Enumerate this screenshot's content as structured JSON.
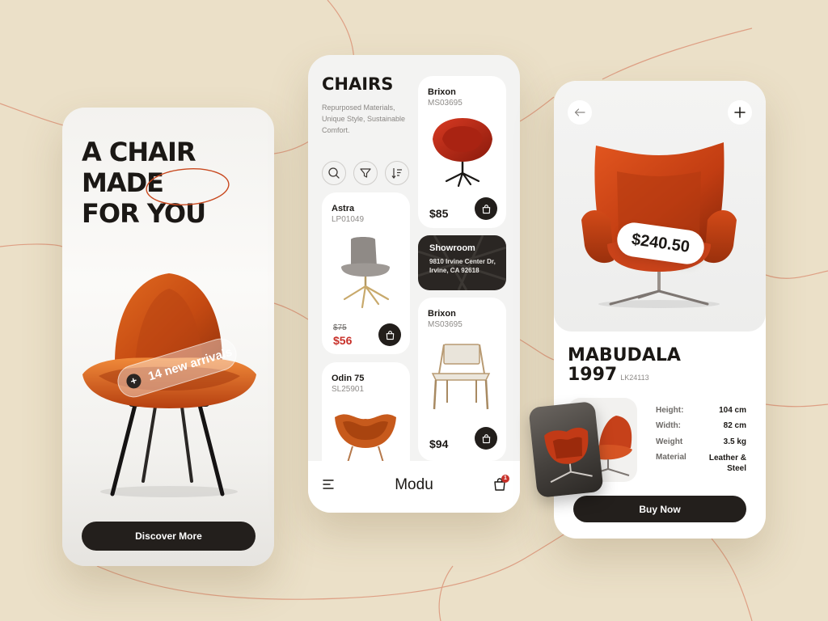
{
  "colors": {
    "background": "#ebe0c8",
    "accent_orange": "#c8481e",
    "dark": "#231f1c",
    "sale_red": "#c8312a"
  },
  "screen1": {
    "headline": [
      "A CHAIR",
      "MADE",
      "FOR YOU"
    ],
    "arrivals_label": "14 new arrivals",
    "discover_label": "Discover More"
  },
  "screen2": {
    "title": "CHAIRS",
    "description": "Repurposed Materials, Unique Style, Sustainable Comfort.",
    "tool_icons": [
      "search-icon",
      "filter-icon",
      "sort-icon"
    ],
    "products": [
      {
        "name": "Brixon",
        "code": "MS03695",
        "price": "$85"
      },
      {
        "name": "Astra",
        "code": "LP01049",
        "old_price": "$75",
        "price": "$56"
      },
      {
        "name": "Brixon",
        "code": "MS03695",
        "price": "$94"
      },
      {
        "name": "Odin 75",
        "code": "SL25901"
      }
    ],
    "showroom": {
      "title": "Showroom",
      "address": "9810 Irvine Center Dr, Irvine, CA 92618"
    },
    "brand": "Modu",
    "cart_count": "1"
  },
  "screen3": {
    "price": "$240.50",
    "title": "MABUDALA",
    "year": "1997",
    "code": "LK24113",
    "specs": [
      {
        "label": "Height:",
        "value": "104 cm"
      },
      {
        "label": "Width:",
        "value": "82 cm"
      },
      {
        "label": "Weight",
        "value": "3.5 kg"
      },
      {
        "label": "Material",
        "value": "Leather & Steel"
      }
    ],
    "buy_label": "Buy Now"
  }
}
